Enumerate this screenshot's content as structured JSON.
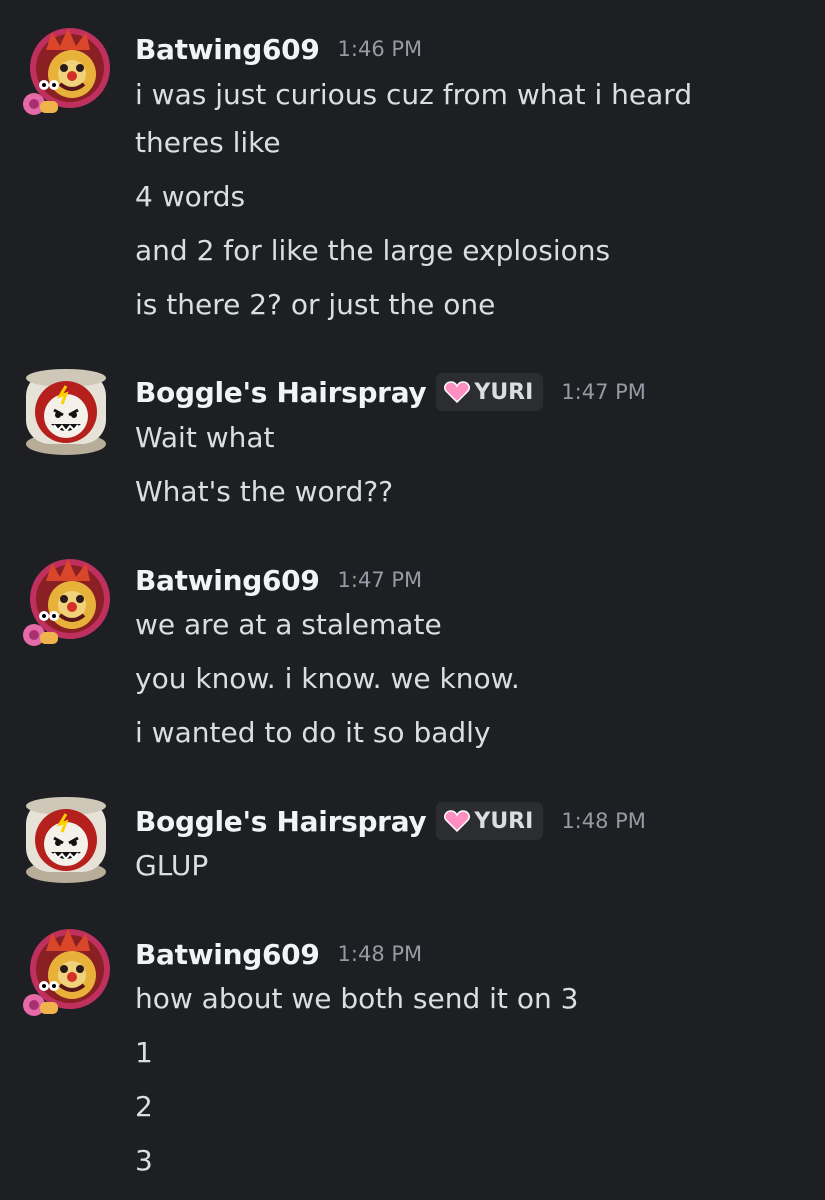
{
  "conversation": {
    "groups": [
      {
        "author": "Batwing609",
        "time": "1:46 PM",
        "avatar_icon": "clown-avatar-icon",
        "lines": [
          "i was just curious cuz from what i heard",
          "theres like",
          "4 words",
          "and 2 for like the large explosions",
          "is there 2? or just the one"
        ]
      },
      {
        "author": "Boggle's Hairspray",
        "tag": "YURI",
        "time": "1:47 PM",
        "avatar_icon": "toilet-face-avatar-icon",
        "lines": [
          "Wait what",
          "What's the word??"
        ]
      },
      {
        "author": "Batwing609",
        "time": "1:47 PM",
        "avatar_icon": "clown-avatar-icon",
        "lines": [
          "we are at a stalemate",
          "you know. i know. we know.",
          "i wanted to do it so badly"
        ]
      },
      {
        "author": "Boggle's Hairspray",
        "tag": "YURI",
        "time": "1:48 PM",
        "avatar_icon": "toilet-face-avatar-icon",
        "lines": [
          "GLUP"
        ]
      },
      {
        "author": "Batwing609",
        "time": "1:48 PM",
        "avatar_icon": "clown-avatar-icon",
        "lines": [
          "how about we both send it on 3",
          "1",
          "2",
          "3"
        ]
      }
    ]
  },
  "colors": {
    "background": "#1e1f22",
    "username": "#f2f3f5",
    "message_text": "#dbdee1",
    "timestamp": "#949ba4",
    "tag_background": "#2b2d31",
    "tag_heart": "#ff8fc0"
  }
}
